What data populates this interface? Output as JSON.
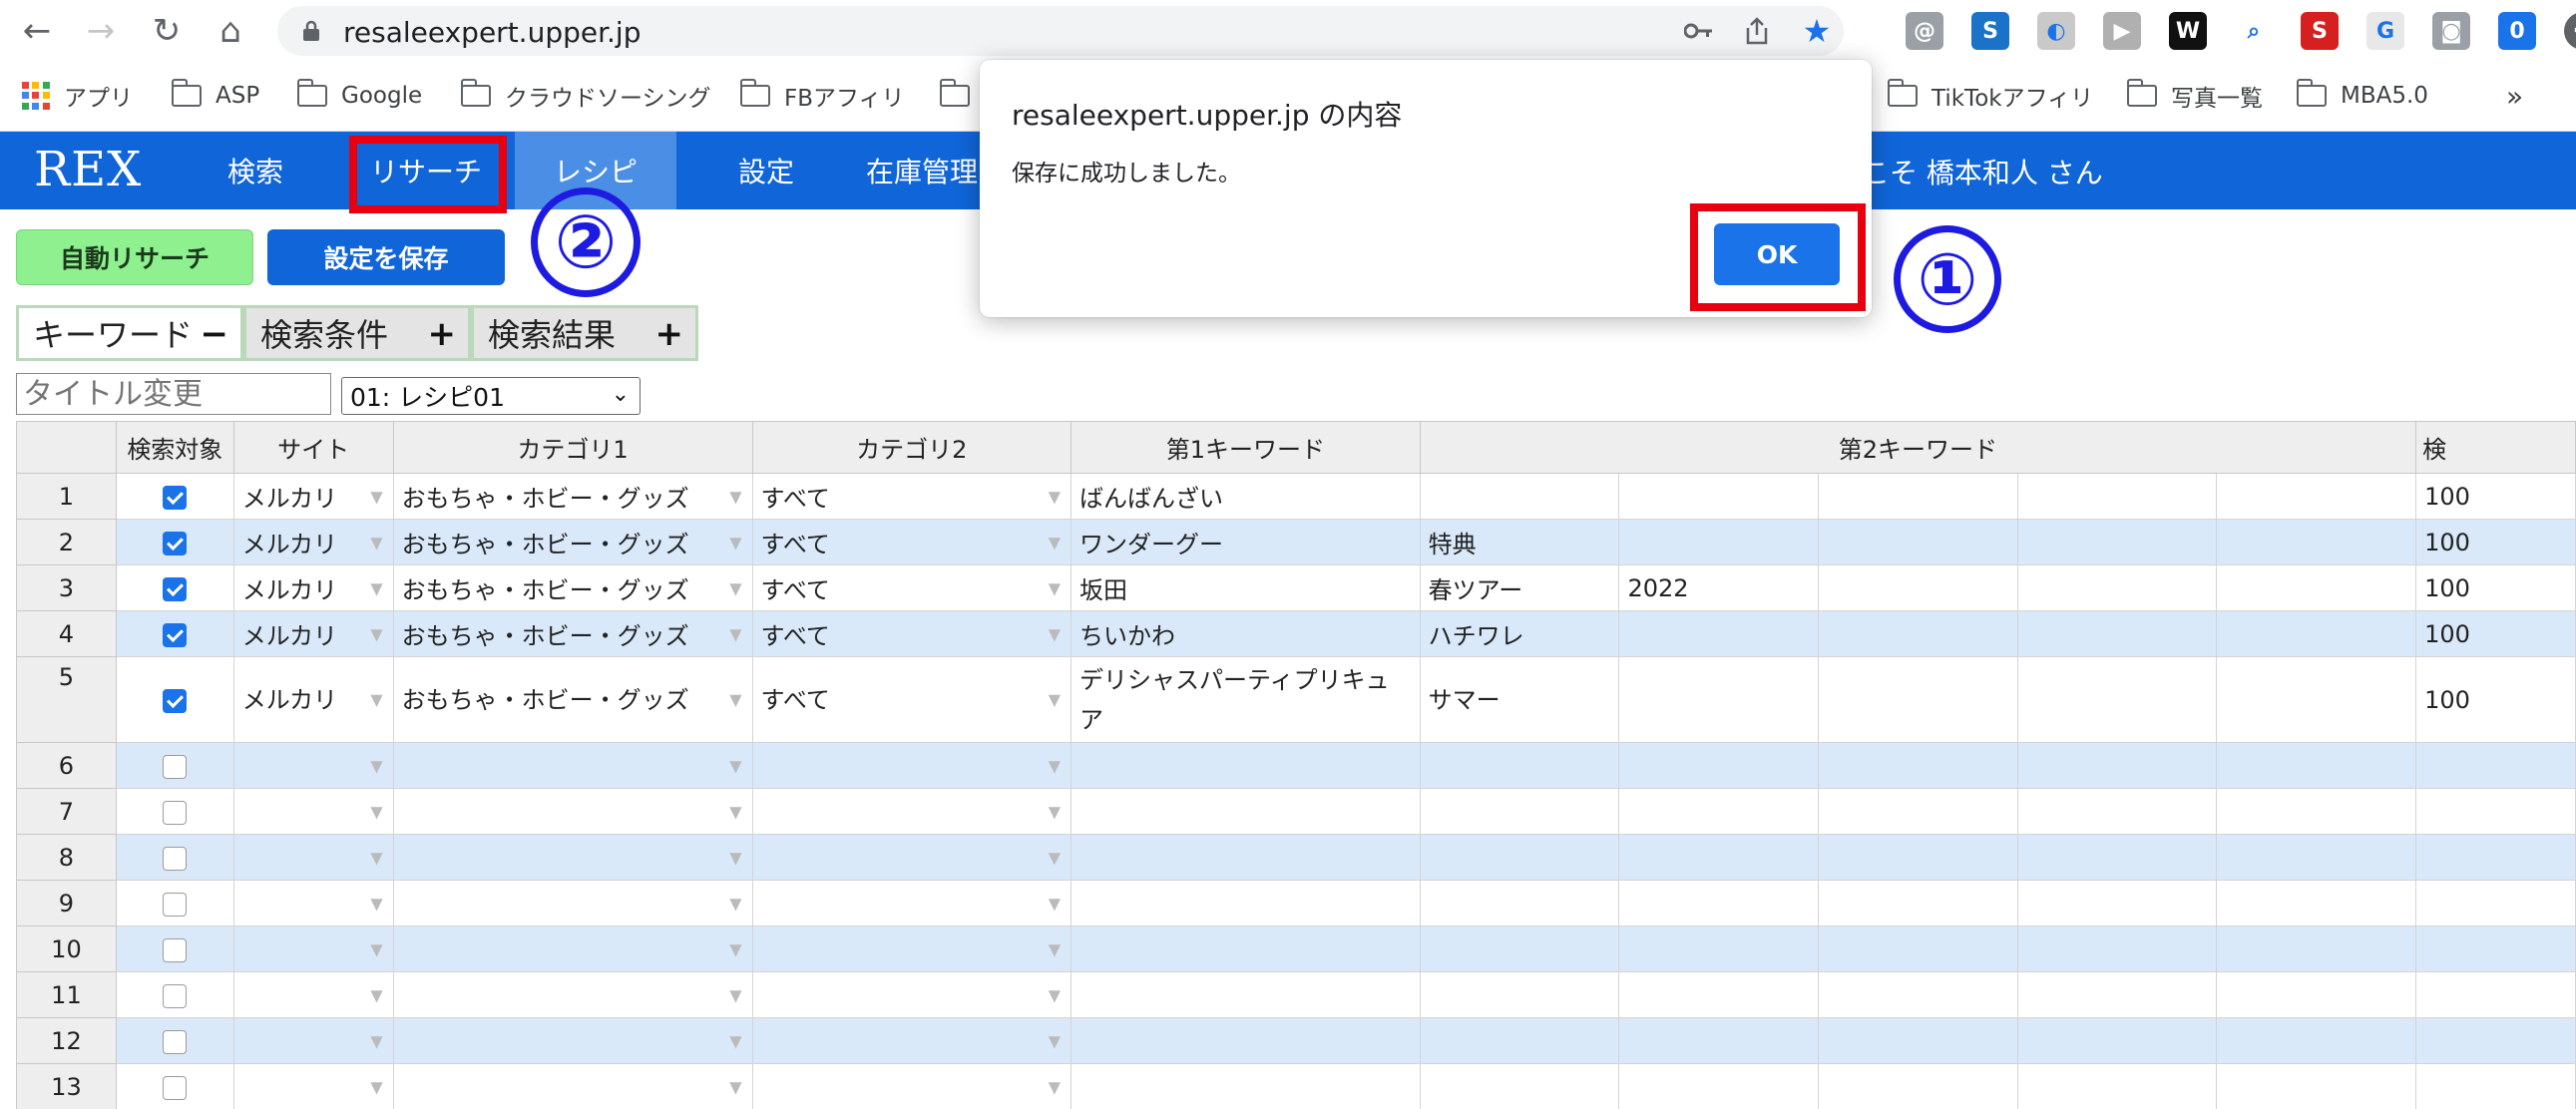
{
  "browser": {
    "url": "resaleexpert.upper.jp",
    "nav_icons": {
      "back": "←",
      "forward": "→",
      "reload": "↻",
      "home": "⌂"
    },
    "omnibox_icons": [
      "key-icon",
      "share-icon",
      "star-icon"
    ],
    "extensions": [
      {
        "name": "extension-at-icon",
        "glyph": "@",
        "bg": "#9aa0a6"
      },
      {
        "name": "extension-s-icon",
        "glyph": "S",
        "bg": "#1a73c8"
      },
      {
        "name": "extension-grey-icon",
        "glyph": "◐",
        "bg": "#c9c9c9"
      },
      {
        "name": "extension-video-icon",
        "glyph": "▶",
        "bg": "#b0b0b0"
      },
      {
        "name": "extension-w-icon",
        "glyph": "W",
        "bg": "#111111"
      },
      {
        "name": "extension-search-icon",
        "glyph": "⌕",
        "bg": "#ffffff"
      },
      {
        "name": "extension-seo-icon",
        "glyph": "S",
        "bg": "#d62020"
      },
      {
        "name": "extension-g-icon",
        "glyph": "G",
        "bg": "#e8e8e8"
      },
      {
        "name": "extension-camera-icon",
        "glyph": "◙",
        "bg": "#9aa0a6"
      },
      {
        "name": "extension-counter-icon",
        "glyph": "0",
        "bg": "#1a73e8"
      }
    ],
    "bookmarks": [
      {
        "label": "アプリ",
        "type": "apps"
      },
      {
        "label": "ASP",
        "type": "folder"
      },
      {
        "label": "Google",
        "type": "folder"
      },
      {
        "label": "クラウドソーシング",
        "type": "folder"
      },
      {
        "label": "FBアフィリ",
        "type": "folder"
      },
      {
        "label": "",
        "type": "folder"
      },
      {
        "label": "TikTokアフィリ",
        "type": "folder"
      },
      {
        "label": "写真一覧",
        "type": "folder"
      },
      {
        "label": "MBA5.0",
        "type": "folder"
      }
    ],
    "bookmarks_overflow": "»"
  },
  "header": {
    "logo": "REX",
    "nav": [
      "検索",
      "リサーチ",
      "レシピ",
      "設定",
      "在庫管理"
    ],
    "welcome": "こそ 橋本和人 さん",
    "color": "#1065d8"
  },
  "toolbar": {
    "auto_research": "自動リサーチ",
    "save_settings": "設定を保存"
  },
  "panels": {
    "keyword": {
      "label": "キーワード",
      "sign": "−"
    },
    "conditions": {
      "label": "検索条件",
      "sign": "+"
    },
    "results": {
      "label": "検索結果",
      "sign": "+"
    }
  },
  "title_input": {
    "placeholder": "タイトル変更"
  },
  "recipe_select": {
    "value": "01: レシピ01"
  },
  "table": {
    "headers": [
      "",
      "検索対象",
      "サイト",
      "カテゴリ1",
      "カテゴリ2",
      "第1キーワード",
      "第2キーワード",
      "検"
    ],
    "rows": [
      {
        "no": "1",
        "checked": true,
        "site": "メルカリ",
        "cat1": "おもちゃ・ホビー・グッズ",
        "cat2": "すべて",
        "kw1": "ばんばんざい",
        "kw2": [
          "",
          "",
          "",
          "",
          ""
        ],
        "num": "100"
      },
      {
        "no": "2",
        "checked": true,
        "site": "メルカリ",
        "cat1": "おもちゃ・ホビー・グッズ",
        "cat2": "すべて",
        "kw1": "ワンダーグー",
        "kw2": [
          "特典",
          "",
          "",
          "",
          ""
        ],
        "num": "100"
      },
      {
        "no": "3",
        "checked": true,
        "site": "メルカリ",
        "cat1": "おもちゃ・ホビー・グッズ",
        "cat2": "すべて",
        "kw1": "坂田",
        "kw2": [
          "春ツアー",
          "2022",
          "",
          "",
          ""
        ],
        "num": "100"
      },
      {
        "no": "4",
        "checked": true,
        "site": "メルカリ",
        "cat1": "おもちゃ・ホビー・グッズ",
        "cat2": "すべて",
        "kw1": "ちいかわ",
        "kw2": [
          "ハチワレ",
          "",
          "",
          "",
          ""
        ],
        "num": "100"
      },
      {
        "no": "5",
        "checked": true,
        "site": "メルカリ",
        "cat1": "おもちゃ・ホビー・グッズ",
        "cat2": "すべて",
        "kw1": "デリシャスパーティプリキュア",
        "kw2": [
          "サマー",
          "",
          "",
          "",
          ""
        ],
        "num": "100"
      },
      {
        "no": "6",
        "checked": false,
        "site": "",
        "cat1": "",
        "cat2": "",
        "kw1": "",
        "kw2": [
          "",
          "",
          "",
          "",
          ""
        ],
        "num": ""
      },
      {
        "no": "7",
        "checked": false,
        "site": "",
        "cat1": "",
        "cat2": "",
        "kw1": "",
        "kw2": [
          "",
          "",
          "",
          "",
          ""
        ],
        "num": ""
      },
      {
        "no": "8",
        "checked": false,
        "site": "",
        "cat1": "",
        "cat2": "",
        "kw1": "",
        "kw2": [
          "",
          "",
          "",
          "",
          ""
        ],
        "num": ""
      },
      {
        "no": "9",
        "checked": false,
        "site": "",
        "cat1": "",
        "cat2": "",
        "kw1": "",
        "kw2": [
          "",
          "",
          "",
          "",
          ""
        ],
        "num": ""
      },
      {
        "no": "10",
        "checked": false,
        "site": "",
        "cat1": "",
        "cat2": "",
        "kw1": "",
        "kw2": [
          "",
          "",
          "",
          "",
          ""
        ],
        "num": ""
      },
      {
        "no": "11",
        "checked": false,
        "site": "",
        "cat1": "",
        "cat2": "",
        "kw1": "",
        "kw2": [
          "",
          "",
          "",
          "",
          ""
        ],
        "num": ""
      },
      {
        "no": "12",
        "checked": false,
        "site": "",
        "cat1": "",
        "cat2": "",
        "kw1": "",
        "kw2": [
          "",
          "",
          "",
          "",
          ""
        ],
        "num": ""
      },
      {
        "no": "13",
        "checked": false,
        "site": "",
        "cat1": "",
        "cat2": "",
        "kw1": "",
        "kw2": [
          "",
          "",
          "",
          "",
          ""
        ],
        "num": ""
      }
    ]
  },
  "dialog": {
    "title": "resaleexpert.upper.jp の内容",
    "message": "保存に成功しました。",
    "ok": "OK"
  },
  "annotations": {
    "step1": "①",
    "step2": "②",
    "highlight_color": "#e8000f",
    "number_color": "#1d1be0"
  }
}
